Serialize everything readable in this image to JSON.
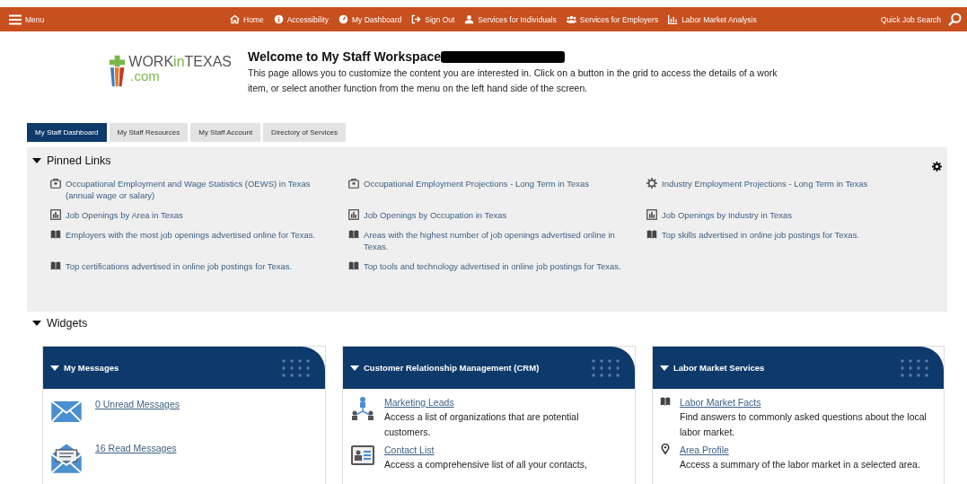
{
  "topbar": {
    "menu": "Menu",
    "nav": [
      {
        "label": "Home",
        "kind": "home"
      },
      {
        "label": "Accessibility",
        "kind": "info"
      },
      {
        "label": "My Dashboard",
        "kind": "gauge"
      },
      {
        "label": "Sign Out",
        "kind": "signout"
      },
      {
        "label": "Services for Individuals",
        "kind": "person"
      },
      {
        "label": "Services for Employers",
        "kind": "group"
      },
      {
        "label": "Labor Market Analysis",
        "kind": "chart"
      }
    ],
    "quick_search": "Quick Job Search"
  },
  "header": {
    "logo_parts": [
      "WORK",
      "in",
      "TEXAS"
    ],
    "logo_domain": ".com",
    "title": "Welcome to My Staff Workspace",
    "description": "This page allows you to customize the content you are interested in. Click on a button in the grid to access the details of a work item, or select another function from the menu on the left hand side of the screen."
  },
  "tabs": [
    {
      "label": "My Staff Dashboard",
      "selected": true
    },
    {
      "label": "My Staff Resources",
      "selected": false
    },
    {
      "label": "My Staff Account",
      "selected": false
    },
    {
      "label": "Directory of Services",
      "selected": false
    }
  ],
  "pinned": {
    "title": "Pinned Links",
    "expanded": true,
    "links": [
      {
        "label": "Occupational Employment and Wage Statistics (OEWS) in Texas (annual wage or salary)",
        "kind": "briefcase"
      },
      {
        "label": "Occupational Employment Projections - Long Term in Texas",
        "kind": "briefcase"
      },
      {
        "label": "Industry Employment Projections - Long Term in Texas",
        "kind": "gear"
      },
      {
        "label": "Job Openings by Area in Texas",
        "kind": "chart"
      },
      {
        "label": "Job Openings by Occupation in Texas",
        "kind": "chart"
      },
      {
        "label": "Job Openings by Industry in Texas",
        "kind": "chart"
      },
      {
        "label": "Employers with the most job openings advertised online for Texas.",
        "kind": "book"
      },
      {
        "label": "Areas with the highest number of job openings advertised online in Texas.",
        "kind": "book"
      },
      {
        "label": "Top skills advertised in online job postings for Texas.",
        "kind": "book"
      },
      {
        "label": "Top certifications advertised in online job postings for Texas.",
        "kind": "book"
      },
      {
        "label": "Top tools and technology advertised in online job postings for Texas.",
        "kind": "book"
      }
    ]
  },
  "widgets": {
    "title": "Widgets",
    "expanded": true,
    "cards": [
      {
        "title": "My Messages",
        "expanded": true,
        "items": [
          {
            "link": "0 Unread Messages",
            "kind": "envelope"
          },
          {
            "link": "16 Read Messages",
            "kind": "envelope-open"
          }
        ]
      },
      {
        "title": "Customer Relationship Management (CRM)",
        "expanded": true,
        "items": [
          {
            "link": "Marketing Leads",
            "kind": "network",
            "text": "Access a list of organizations that are potential customers."
          },
          {
            "link": "Contact List",
            "kind": "contact",
            "text": "Access a comprehensive list of all your contacts,"
          }
        ]
      },
      {
        "title": "Labor Market Services",
        "expanded": true,
        "items": [
          {
            "link": "Labor Market Facts",
            "kind": "book",
            "text": "Find answers to commonly asked questions about the local labor market."
          },
          {
            "link": "Area Profile",
            "kind": "pin",
            "text": "Access a summary of the labor market in a selected area."
          }
        ]
      }
    ]
  }
}
